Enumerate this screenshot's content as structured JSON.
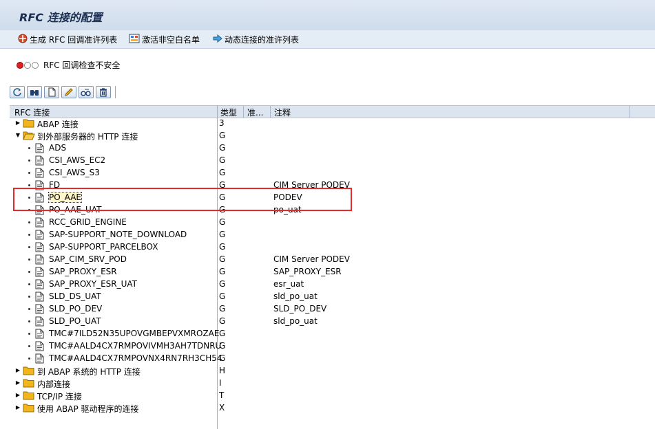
{
  "title": "RFC 连接的配置",
  "toolbar": {
    "items": [
      {
        "label": "生成 RFC 回调准许列表",
        "icon": "generate-icon"
      },
      {
        "label": "激活非空白名单",
        "icon": "activate-icon"
      },
      {
        "label": "动态连接的准许列表",
        "icon": "arrow-right-icon"
      }
    ]
  },
  "warning": {
    "text": "RFC 回调检查不安全"
  },
  "buttons": [
    "refresh-icon",
    "find-icon",
    "create-icon",
    "edit-icon",
    "copy-icon",
    "delete-icon"
  ],
  "columns": {
    "name": "RFC 连接",
    "type": "类型",
    "accept": "准...",
    "comment": "注释"
  },
  "tree": [
    {
      "label": "ABAP 连接",
      "type": "3",
      "comment": "",
      "level": 0,
      "kind": "folder",
      "expanded": false
    },
    {
      "label": "到外部服务器的 HTTP 连接",
      "type": "G",
      "comment": "",
      "level": 0,
      "kind": "folder",
      "expanded": true
    },
    {
      "label": "ADS",
      "type": "G",
      "comment": "",
      "level": 1,
      "kind": "doc"
    },
    {
      "label": "CSI_AWS_EC2",
      "type": "G",
      "comment": "",
      "level": 1,
      "kind": "doc"
    },
    {
      "label": "CSI_AWS_S3",
      "type": "G",
      "comment": "",
      "level": 1,
      "kind": "doc"
    },
    {
      "label": "FD",
      "type": "G",
      "comment": "CIM Server PODEV",
      "level": 1,
      "kind": "doc"
    },
    {
      "label": "PO_AAE",
      "type": "G",
      "comment": "PODEV",
      "level": 1,
      "kind": "doc",
      "focused": true
    },
    {
      "label": "PO_AAE_UAT",
      "type": "G",
      "comment": "po_uat",
      "level": 1,
      "kind": "doc"
    },
    {
      "label": "RCC_GRID_ENGINE",
      "type": "G",
      "comment": "",
      "level": 1,
      "kind": "doc"
    },
    {
      "label": "SAP-SUPPORT_NOTE_DOWNLOAD",
      "type": "G",
      "comment": "",
      "level": 1,
      "kind": "doc"
    },
    {
      "label": "SAP-SUPPORT_PARCELBOX",
      "type": "G",
      "comment": "",
      "level": 1,
      "kind": "doc"
    },
    {
      "label": "SAP_CIM_SRV_POD",
      "type": "G",
      "comment": "CIM Server PODEV",
      "level": 1,
      "kind": "doc"
    },
    {
      "label": "SAP_PROXY_ESR",
      "type": "G",
      "comment": "SAP_PROXY_ESR",
      "level": 1,
      "kind": "doc"
    },
    {
      "label": "SAP_PROXY_ESR_UAT",
      "type": "G",
      "comment": "esr_uat",
      "level": 1,
      "kind": "doc"
    },
    {
      "label": "SLD_DS_UAT",
      "type": "G",
      "comment": "sld_po_uat",
      "level": 1,
      "kind": "doc"
    },
    {
      "label": "SLD_PO_DEV",
      "type": "G",
      "comment": "SLD_PO_DEV",
      "level": 1,
      "kind": "doc"
    },
    {
      "label": "SLD_PO_UAT",
      "type": "G",
      "comment": "sld_po_uat",
      "level": 1,
      "kind": "doc"
    },
    {
      "label": "TMC#7ILD52N35UPOVGMBEPVXMROZAE",
      "type": "G",
      "comment": "",
      "level": 1,
      "kind": "doc"
    },
    {
      "label": "TMC#AALD4CX7RMPOVIVMH3AH7TDNRU",
      "type": "G",
      "comment": "",
      "level": 1,
      "kind": "doc"
    },
    {
      "label": "TMC#AALD4CX7RMPOVNX4RN7RH3CH54",
      "type": "G",
      "comment": "",
      "level": 1,
      "kind": "doc"
    },
    {
      "label": "到 ABAP 系统的 HTTP 连接",
      "type": "H",
      "comment": "",
      "level": 0,
      "kind": "folder",
      "expanded": false
    },
    {
      "label": "内部连接",
      "type": "I",
      "comment": "",
      "level": 0,
      "kind": "folder",
      "expanded": false
    },
    {
      "label": "TCP/IP 连接",
      "type": "T",
      "comment": "",
      "level": 0,
      "kind": "folder",
      "expanded": false
    },
    {
      "label": "使用 ABAP 驱动程序的连接",
      "type": "X",
      "comment": "",
      "level": 0,
      "kind": "folder",
      "expanded": false
    }
  ],
  "colors": {
    "highlight": "#e32b2b",
    "folder": "#f2b51b"
  }
}
